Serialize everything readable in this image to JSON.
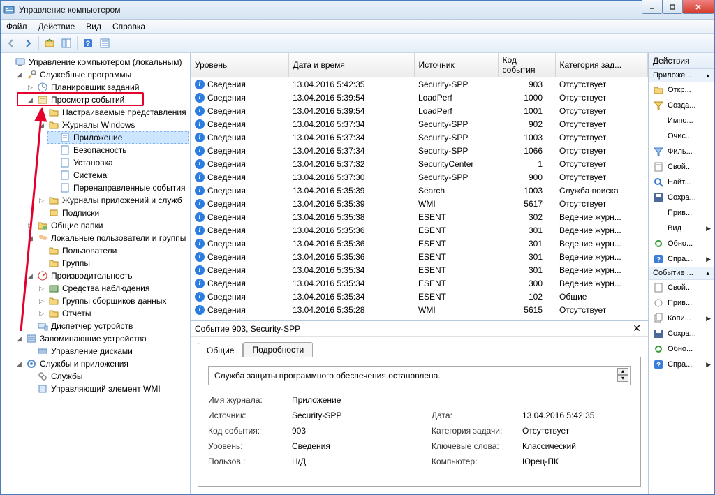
{
  "window": {
    "title": "Управление компьютером"
  },
  "menu": {
    "file": "Файл",
    "action": "Действие",
    "view": "Вид",
    "help": "Справка"
  },
  "tree": {
    "root": "Управление компьютером (локальным)",
    "system_tools": "Служебные программы",
    "task_scheduler": "Планировщик заданий",
    "event_viewer": "Просмотр событий",
    "custom_views": "Настраиваемые представления",
    "windows_logs": "Журналы Windows",
    "application": "Приложение",
    "security_log": "Безопасность",
    "setup": "Установка",
    "system": "Система",
    "forwarded": "Перенаправленные события",
    "app_services_logs": "Журналы приложений и служб",
    "subscriptions": "Подписки",
    "shared_folders": "Общие папки",
    "local_users_groups": "Локальные пользователи и группы",
    "users": "Пользователи",
    "groups": "Группы",
    "performance": "Производительность",
    "monitoring_tools": "Средства наблюдения",
    "data_collector_sets": "Группы сборщиков данных",
    "reports": "Отчеты",
    "device_manager": "Диспетчер устройств",
    "storage": "Запоминающие устройства",
    "disk_management": "Управление дисками",
    "services_apps": "Службы и приложения",
    "services": "Службы",
    "wmi_control": "Управляющий элемент WMI"
  },
  "list": {
    "columns": {
      "level": "Уровень",
      "datetime": "Дата и время",
      "source": "Источник",
      "event_id": "Код события",
      "category": "Категория зад..."
    },
    "level_info": "Сведения",
    "cat_none": "Отсутствует",
    "cat_search": "Служба поиска",
    "cat_journal": "Ведение журн...",
    "cat_general": "Общие",
    "rows": [
      {
        "dt": "13.04.2016 5:42:35",
        "src": "Security-SPP",
        "id": "903",
        "cat": "none"
      },
      {
        "dt": "13.04.2016 5:39:54",
        "src": "LoadPerf",
        "id": "1000",
        "cat": "none"
      },
      {
        "dt": "13.04.2016 5:39:54",
        "src": "LoadPerf",
        "id": "1001",
        "cat": "none"
      },
      {
        "dt": "13.04.2016 5:37:34",
        "src": "Security-SPP",
        "id": "902",
        "cat": "none"
      },
      {
        "dt": "13.04.2016 5:37:34",
        "src": "Security-SPP",
        "id": "1003",
        "cat": "none"
      },
      {
        "dt": "13.04.2016 5:37:34",
        "src": "Security-SPP",
        "id": "1066",
        "cat": "none"
      },
      {
        "dt": "13.04.2016 5:37:32",
        "src": "SecurityCenter",
        "id": "1",
        "cat": "none"
      },
      {
        "dt": "13.04.2016 5:37:30",
        "src": "Security-SPP",
        "id": "900",
        "cat": "none"
      },
      {
        "dt": "13.04.2016 5:35:39",
        "src": "Search",
        "id": "1003",
        "cat": "search"
      },
      {
        "dt": "13.04.2016 5:35:39",
        "src": "WMI",
        "id": "5617",
        "cat": "none"
      },
      {
        "dt": "13.04.2016 5:35:38",
        "src": "ESENT",
        "id": "302",
        "cat": "journal"
      },
      {
        "dt": "13.04.2016 5:35:36",
        "src": "ESENT",
        "id": "301",
        "cat": "journal"
      },
      {
        "dt": "13.04.2016 5:35:36",
        "src": "ESENT",
        "id": "301",
        "cat": "journal"
      },
      {
        "dt": "13.04.2016 5:35:36",
        "src": "ESENT",
        "id": "301",
        "cat": "journal"
      },
      {
        "dt": "13.04.2016 5:35:34",
        "src": "ESENT",
        "id": "301",
        "cat": "journal"
      },
      {
        "dt": "13.04.2016 5:35:34",
        "src": "ESENT",
        "id": "300",
        "cat": "journal"
      },
      {
        "dt": "13.04.2016 5:35:34",
        "src": "ESENT",
        "id": "102",
        "cat": "general"
      },
      {
        "dt": "13.04.2016 5:35:28",
        "src": "WMI",
        "id": "5615",
        "cat": "none"
      }
    ]
  },
  "details": {
    "header": "Событие 903, Security-SPP",
    "tabs": {
      "general": "Общие",
      "details": "Подробности"
    },
    "description": "Служба защиты программного обеспечения остановлена.",
    "fields": {
      "log_name_k": "Имя журнала:",
      "log_name_v": "Приложение",
      "source_k": "Источник:",
      "source_v": "Security-SPP",
      "date_k": "Дата:",
      "date_v": "13.04.2016 5:42:35",
      "event_id_k": "Код события:",
      "event_id_v": "903",
      "task_cat_k": "Категория задачи:",
      "task_cat_v": "Отсутствует",
      "level_k": "Уровень:",
      "level_v": "Сведения",
      "keywords_k": "Ключевые слова:",
      "keywords_v": "Классический",
      "user_k": "Пользов.:",
      "user_v": "Н/Д",
      "computer_k": "Компьютер:",
      "computer_v": "Юрец-ПК"
    }
  },
  "actions": {
    "header": "Действия",
    "section_app": "Приложе...",
    "open": "Откр...",
    "create": "Созда...",
    "import": "Импо...",
    "clear": "Очис...",
    "filter": "Филь...",
    "properties": "Свой...",
    "find": "Найт...",
    "save": "Сохра...",
    "attach": "Прив...",
    "view": "Вид",
    "refresh": "Обно...",
    "help": "Спра...",
    "section_event": "Событие ...",
    "properties2": "Свой...",
    "attach2": "Прив...",
    "copy": "Копи...",
    "save2": "Сохра...",
    "refresh2": "Обно...",
    "help2": "Спра..."
  }
}
